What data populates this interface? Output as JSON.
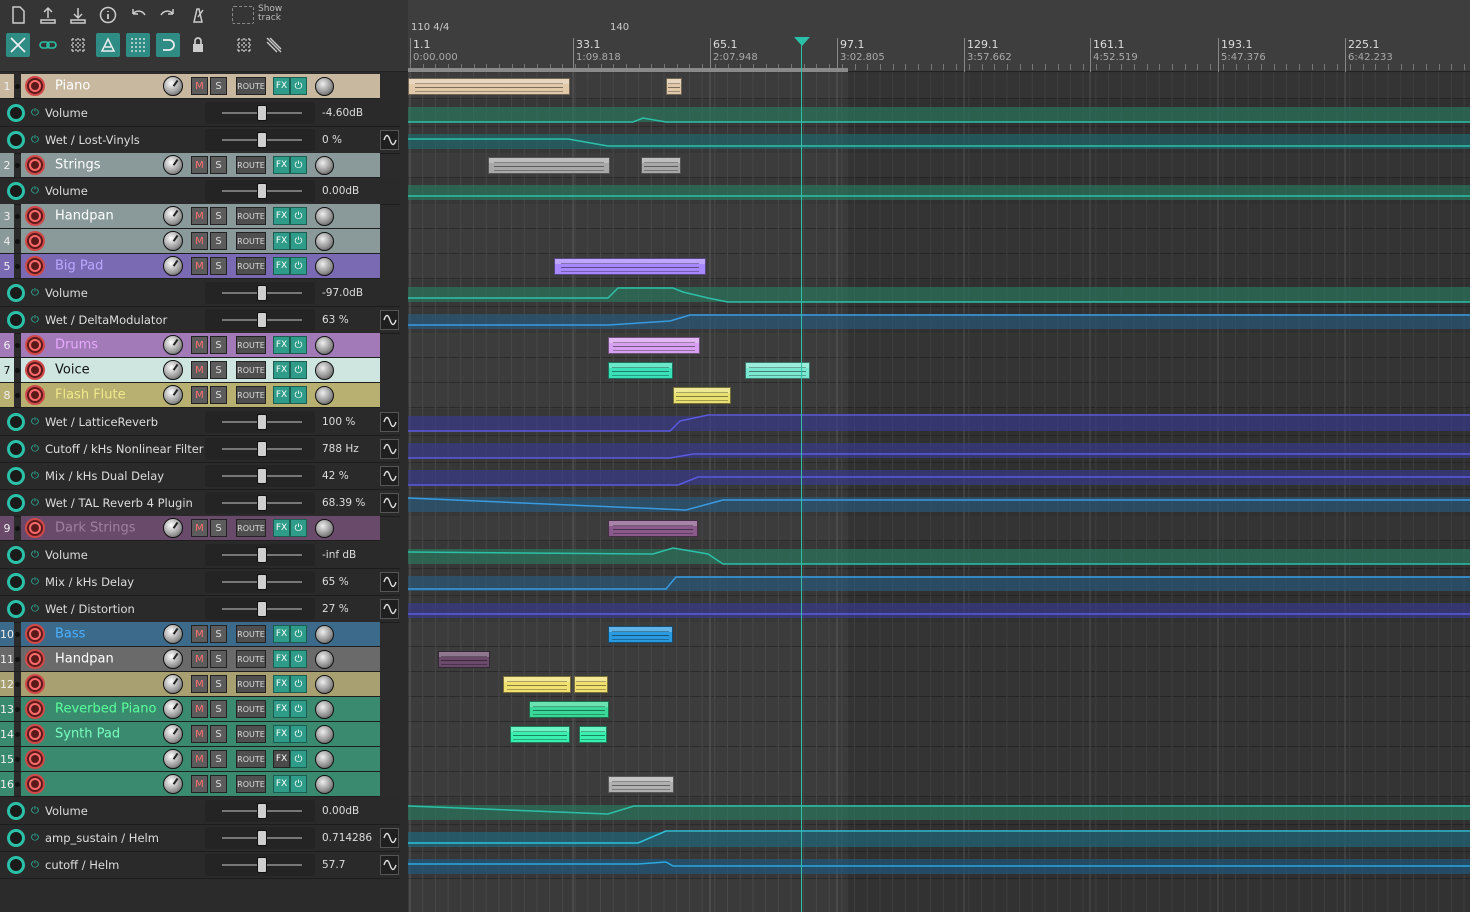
{
  "toolbar": {
    "show_track_label": "Show track",
    "icons_row1": [
      "new-file-icon",
      "open-icon",
      "save-icon",
      "info-icon",
      "undo-icon",
      "redo-icon",
      "metronome-icon"
    ],
    "icons_row2": [
      "ripple-icon",
      "link-icon",
      "grid-icon",
      "snap-icon",
      "quantize-icon",
      "loop-icon",
      "lock-icon"
    ]
  },
  "ruler": {
    "tempo": [
      "110 4/4",
      "140"
    ],
    "markers": [
      {
        "bar": "1.1",
        "time": "0:00.000"
      },
      {
        "bar": "33.1",
        "time": "1:09.818"
      },
      {
        "bar": "65.1",
        "time": "2:07.948"
      },
      {
        "bar": "97.1",
        "time": "3:02.805"
      },
      {
        "bar": "129.1",
        "time": "3:57.662"
      },
      {
        "bar": "161.1",
        "time": "4:52.519"
      },
      {
        "bar": "193.1",
        "time": "5:47.376"
      },
      {
        "bar": "225.1",
        "time": "6:42.233"
      }
    ]
  },
  "tracks": [
    {
      "num": "1",
      "name": "Piano",
      "color": "#c8b8a0",
      "name_color": "#ffffff",
      "fx_on": true
    },
    {
      "num": "2",
      "name": "Strings",
      "color": "#8a9a9a",
      "name_color": "#ffffff",
      "fx_on": true
    },
    {
      "num": "3",
      "name": "Handpan",
      "color": "#8a9a9a",
      "name_color": "#ffffff",
      "fx_on": true
    },
    {
      "num": "4",
      "name": "",
      "color": "#8a9a9a",
      "name_color": "#ffffff",
      "fx_on": true
    },
    {
      "num": "5",
      "name": "Big Pad",
      "color": "#7a6ab4",
      "name_color": "#b9a8ff",
      "fx_on": true
    },
    {
      "num": "6",
      "name": "Drums",
      "color": "#a27ab8",
      "name_color": "#e8a8ff",
      "fx_on": true
    },
    {
      "num": "7",
      "name": "Voice",
      "color": "#cfe6e0",
      "name_color": "#111111",
      "fx_on": true
    },
    {
      "num": "8",
      "name": "Flash Flute",
      "color": "#b8b070",
      "name_color": "#f0e88a",
      "fx_on": true
    },
    {
      "num": "9",
      "name": "Dark Strings",
      "color": "#6a4a6a",
      "name_color": "#a080a0",
      "fx_on": true
    },
    {
      "num": "10",
      "name": "Bass",
      "color": "#3c6a8a",
      "name_color": "#4ab0ff",
      "fx_on": true
    },
    {
      "num": "11",
      "name": "Handpan",
      "color": "#6a6a6a",
      "name_color": "#ffffff",
      "fx_on": true
    },
    {
      "num": "12",
      "name": "",
      "color": "#a8a070",
      "name_color": "#ffffff",
      "fx_on": true
    },
    {
      "num": "13",
      "name": "Reverbed Piano",
      "color": "#3a8a70",
      "name_color": "#5aff9a",
      "fx_on": true
    },
    {
      "num": "14",
      "name": "Synth Pad",
      "color": "#3a8a70",
      "name_color": "#7affc0",
      "fx_on": true
    },
    {
      "num": "15",
      "name": "",
      "color": "#3a8a70",
      "name_color": "#ffffff",
      "fx_on": false
    },
    {
      "num": "16",
      "name": "",
      "color": "#3a8a70",
      "name_color": "#ffffff",
      "fx_on": true
    }
  ],
  "track_buttons": {
    "mute": "M",
    "solo": "S",
    "route": "ROUTE",
    "fx": "FX",
    "power": "⏻"
  },
  "envelopes": [
    {
      "name": "Volume",
      "value": "-4.60dB",
      "mod": false
    },
    {
      "name": "Wet / Lost-Vinyls",
      "value": "0 %",
      "mod": true
    },
    {
      "name": "Volume",
      "value": "0.00dB",
      "mod": false
    },
    {
      "name": "Volume",
      "value": "-97.0dB",
      "mod": false
    },
    {
      "name": "Wet / DeltaModulator",
      "value": "63 %",
      "mod": true
    },
    {
      "name": "Wet / LatticeReverb",
      "value": "100 %",
      "mod": true
    },
    {
      "name": "Cutoff / kHs Nonlinear Filter",
      "value": "788 Hz",
      "mod": true
    },
    {
      "name": "Mix / kHs Dual Delay",
      "value": "42 %",
      "mod": true
    },
    {
      "name": "Wet / TAL Reverb 4 Plugin",
      "value": "68.39 %",
      "mod": true
    },
    {
      "name": "Volume",
      "value": "-inf dB",
      "mod": false
    },
    {
      "name": "Mix / kHs Delay",
      "value": "65 %",
      "mod": true
    },
    {
      "name": "Wet / Distortion",
      "value": "27 %",
      "mod": true
    },
    {
      "name": "Volume",
      "value": "0.00dB",
      "mod": false
    },
    {
      "name": "amp_sustain / Helm",
      "value": "0.714286",
      "mod": true
    },
    {
      "name": "cutoff / Helm",
      "value": "57.7",
      "mod": true
    }
  ]
}
